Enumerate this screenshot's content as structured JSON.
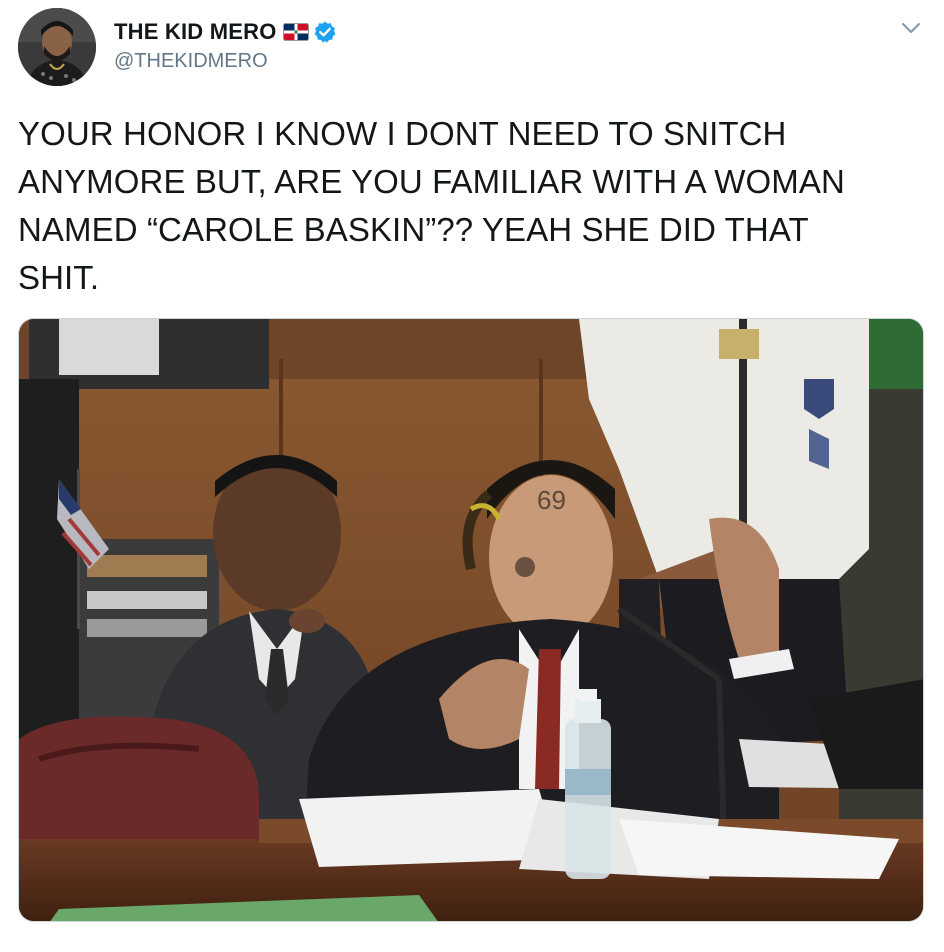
{
  "tweet": {
    "author": {
      "display_name": "THE KID MERO",
      "handle": "@THEKIDMERO",
      "verified": true,
      "flag_icon": "dominican-republic-flag-icon",
      "avatar_icon": "profile-avatar"
    },
    "text": "YOUR HONOR I KNOW I DONT NEED TO SNITCH\nANYMORE BUT, ARE YOU FAMILIAR WITH A WOMAN\nNAMED “CAROLE BASKIN”?? YEAH SHE DID THAT\nSHIT.",
    "menu_icon": "chevron-down-icon",
    "media": {
      "image_subject": "courtroom-photo"
    }
  },
  "colors": {
    "text_primary": "#14171a",
    "text_secondary": "#657786",
    "verified_blue": "#1da1f2",
    "border": "#ccd6dd"
  }
}
